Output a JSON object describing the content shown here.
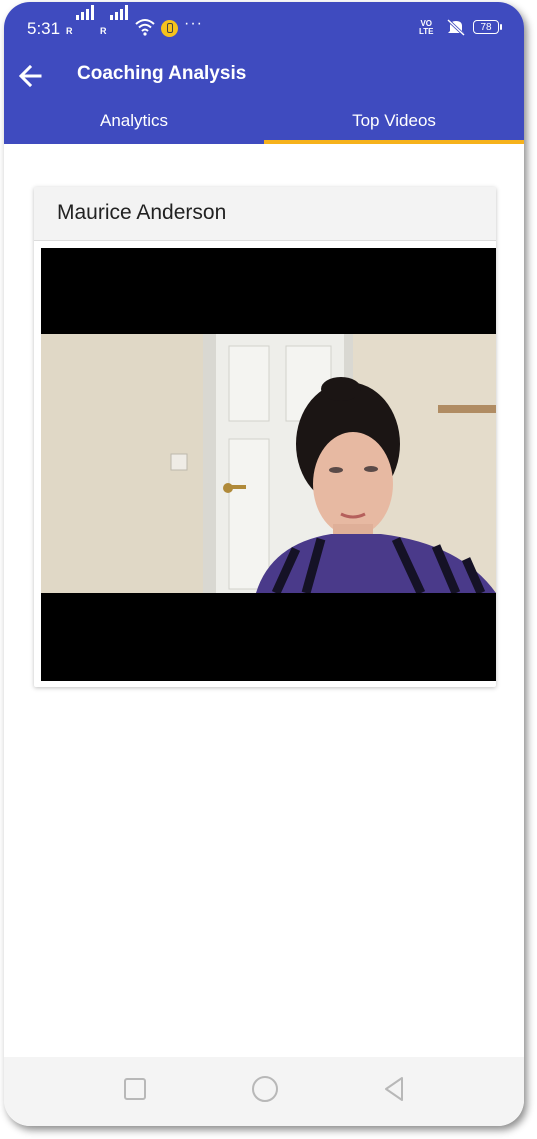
{
  "status_bar": {
    "time": "5:31",
    "signal1_label": "R",
    "signal2_label": "R",
    "more": "···",
    "volte": [
      "VO",
      "LTE"
    ],
    "battery": "78"
  },
  "app_bar": {
    "title": "Coaching Analysis"
  },
  "tabs": [
    {
      "label": "Analytics",
      "active": false
    },
    {
      "label": "Top Videos",
      "active": true
    }
  ],
  "colors": {
    "app_bar": "#3f4bbf",
    "tab_indicator": "#f6b21c"
  },
  "video_card": {
    "name": "Maurice Anderson"
  },
  "icons": [
    "back-arrow-icon",
    "wifi-icon",
    "hotspot-icon",
    "mute-icon",
    "battery-icon",
    "recents-icon",
    "home-icon",
    "nav-back-icon"
  ]
}
